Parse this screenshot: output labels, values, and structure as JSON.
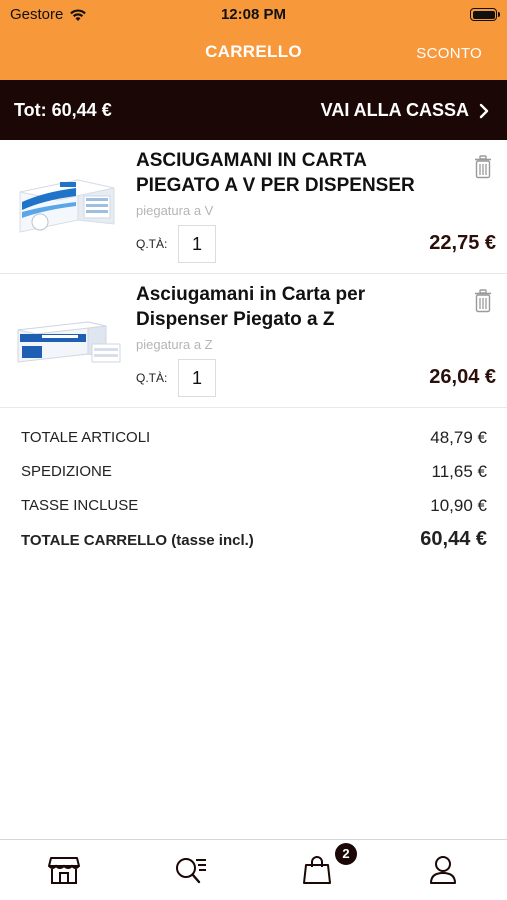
{
  "status_bar": {
    "carrier": "Gestore",
    "time": "12:08 PM"
  },
  "navbar": {
    "title": "CARRELLO",
    "action_label": "SCONTO"
  },
  "total_bar": {
    "total_label": "Tot: 60,44 €",
    "checkout_label": "VAI ALLA CASSA"
  },
  "cart": {
    "qty_label": "Q.TÀ:",
    "items": [
      {
        "title": "ASCIUGAMANI IN CARTA PIEGATO A V PER DISPENSER",
        "variant": "piegatura a V",
        "quantity": "1",
        "price": "22,75 €"
      },
      {
        "title": "Asciugamani in Carta per Dispenser Piegato a Z",
        "variant": "piegatura a Z",
        "quantity": "1",
        "price": "26,04 €"
      }
    ]
  },
  "summary": {
    "rows": [
      {
        "label": "TOTALE ARTICOLI",
        "value": "48,79 €"
      },
      {
        "label": "SPEDIZIONE",
        "value": "11,65 €"
      },
      {
        "label": "TASSE INCLUSE",
        "value": "10,90 €"
      }
    ],
    "total": {
      "label": "TOTALE CARRELLO (tasse incl.)",
      "value": "60,44 €"
    }
  },
  "tabbar": {
    "tabs": [
      "store-icon",
      "search-icon",
      "cart-icon",
      "account-icon"
    ],
    "cart_badge": "2"
  },
  "colors": {
    "header": "#f7983a",
    "dark": "#1b0806"
  }
}
